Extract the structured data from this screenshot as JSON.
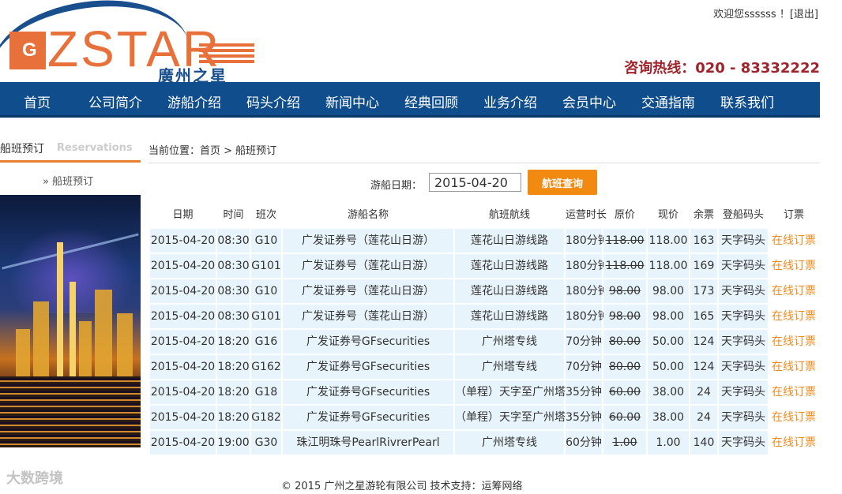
{
  "header": {
    "logo_text": "ZSTAR",
    "logo_letter": "G",
    "logo_sub": "廣州之星",
    "welcome": "欢迎您ssssss ！",
    "logout": "[退出]",
    "hotline": "咨询热线：020 - 83332222"
  },
  "nav": [
    "首页",
    "公司简介",
    "游船介绍",
    "码头介绍",
    "新闻中心",
    "经典回顾",
    "业务介绍",
    "会员中心",
    "交通指南",
    "联系我们"
  ],
  "sidebar": {
    "title": "船班预订",
    "title_en": "Reservations",
    "link": "» 船班预订"
  },
  "breadcrumb": "当前位置：首页 > 船班预订",
  "search": {
    "label": "游船日期：",
    "value": "2015-04-20",
    "button": "航班查询"
  },
  "table": {
    "headers": [
      "日期",
      "时间",
      "班次",
      "游船名称",
      "航班航线",
      "运营时长",
      "原价",
      "现价",
      "余票",
      "登船码头",
      "订票"
    ],
    "rows": [
      [
        "2015-04-20",
        "08:30",
        "G10",
        "广发证券号（莲花山日游）",
        "莲花山日游线路",
        "180分钟",
        "118.00",
        "118.00",
        "163",
        "天字码头",
        "在线订票"
      ],
      [
        "2015-04-20",
        "08:30",
        "G101",
        "广发证券号（莲花山日游）",
        "莲花山日游线路",
        "180分钟",
        "118.00",
        "118.00",
        "169",
        "天字码头",
        "在线订票"
      ],
      [
        "2015-04-20",
        "08:30",
        "G10",
        "广发证券号（莲花山日游）",
        "莲花山日游线路",
        "180分钟",
        "98.00",
        "98.00",
        "173",
        "天字码头",
        "在线订票"
      ],
      [
        "2015-04-20",
        "08:30",
        "G101",
        "广发证券号（莲花山日游）",
        "莲花山日游线路",
        "180分钟",
        "98.00",
        "98.00",
        "165",
        "天字码头",
        "在线订票"
      ],
      [
        "2015-04-20",
        "18:20",
        "G16",
        "广发证券号GFsecurities",
        "广州塔专线",
        "70分钟",
        "80.00",
        "50.00",
        "124",
        "天字码头",
        "在线订票"
      ],
      [
        "2015-04-20",
        "18:20",
        "G162",
        "广发证券号GFsecurities",
        "广州塔专线",
        "70分钟",
        "80.00",
        "50.00",
        "124",
        "天字码头",
        "在线订票"
      ],
      [
        "2015-04-20",
        "18:20",
        "G18",
        "广发证券号GFsecurities",
        "（单程）天字至广州塔",
        "35分钟",
        "60.00",
        "38.00",
        "24",
        "天字码头",
        "在线订票"
      ],
      [
        "2015-04-20",
        "18:20",
        "G182",
        "广发证券号GFsecurities",
        "（单程）天字至广州塔",
        "35分钟",
        "60.00",
        "38.00",
        "24",
        "天字码头",
        "在线订票"
      ],
      [
        "2015-04-20",
        "19:00",
        "G30",
        "珠江明珠号PearlRivrerPearl",
        "广州塔专线",
        "60分钟",
        "1.00",
        "1.00",
        "140",
        "天字码头",
        "在线订票"
      ]
    ]
  },
  "footer": "© 2015 广州之星游轮有限公司 技术支持：运筹网络",
  "watermark": "大数跨境",
  "colors": {
    "nav_bg": "#0f4d8c",
    "accent": "#f28a12",
    "row_bg": "#e8f4fb",
    "hotline": "#a0222a"
  }
}
